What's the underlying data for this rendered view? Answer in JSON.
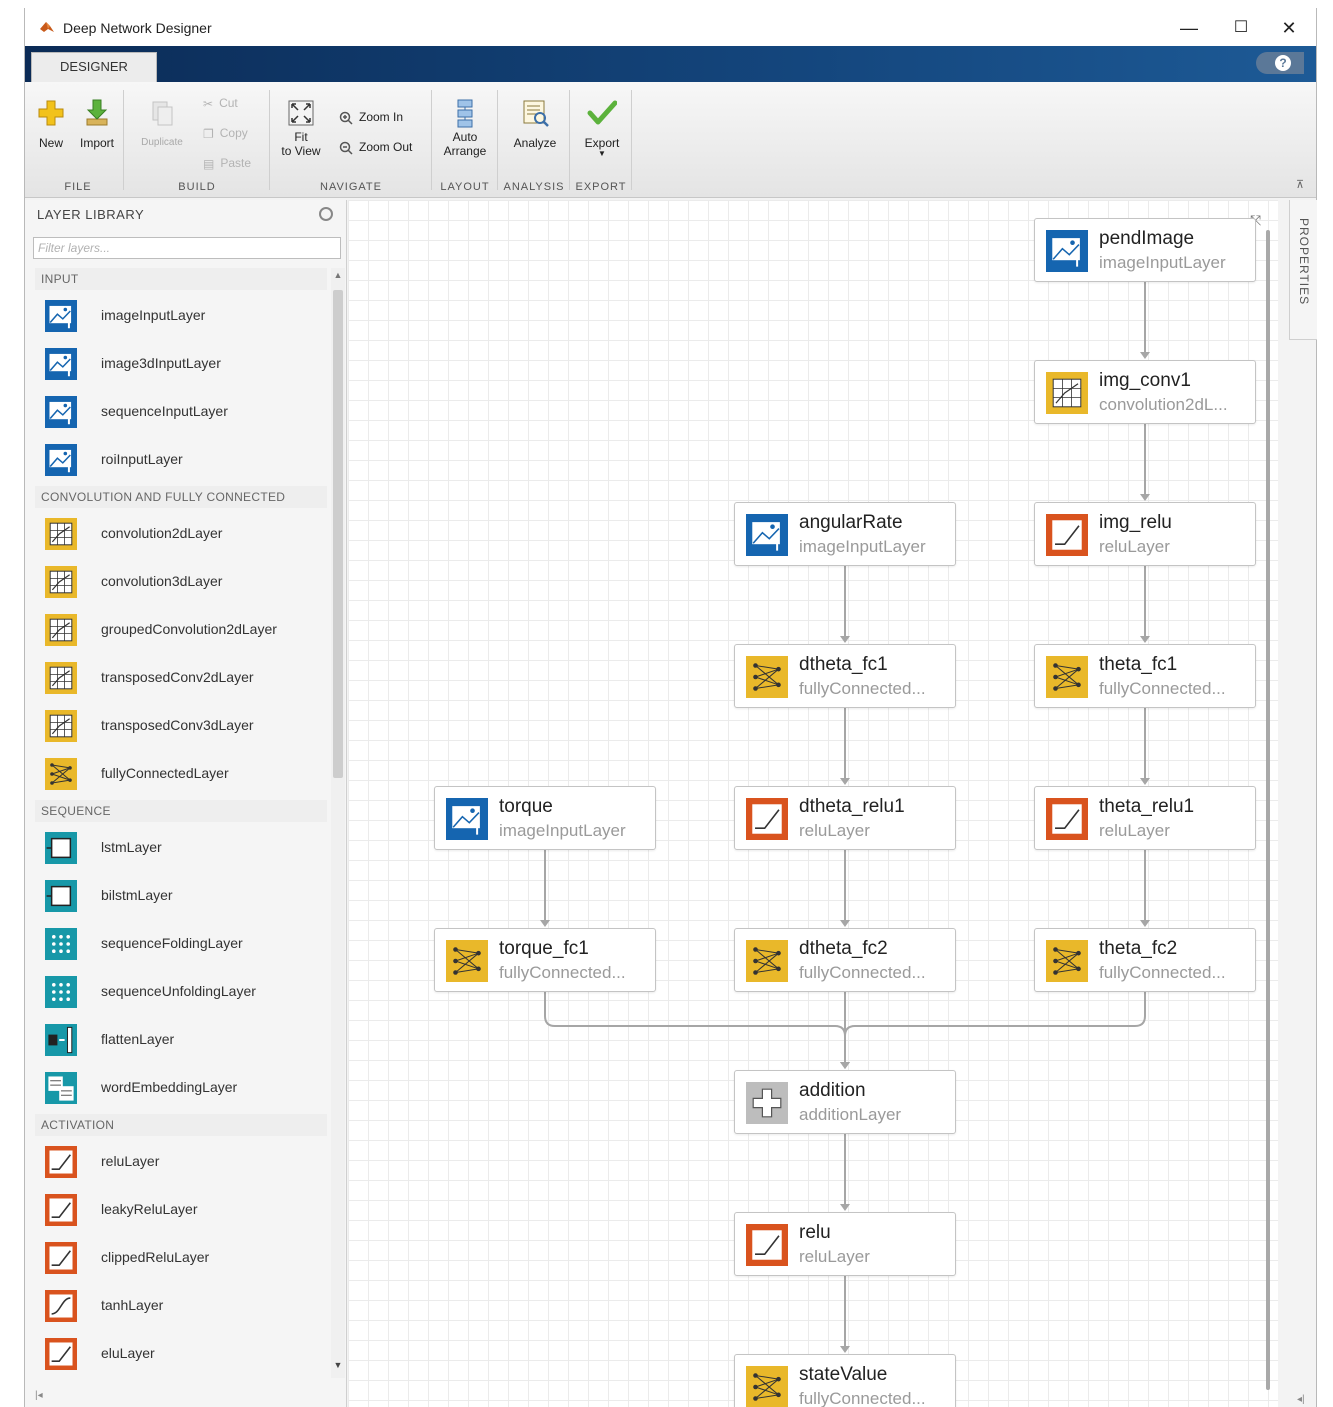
{
  "window": {
    "title": "Deep Network Designer"
  },
  "window_controls": {
    "minimize": "—",
    "maximize": "☐",
    "close": "✕"
  },
  "tabs": [
    {
      "label": "DESIGNER"
    }
  ],
  "help": {
    "label": "?"
  },
  "toolstrip": {
    "new": "New",
    "import": "Import",
    "duplicate": "Duplicate",
    "cut": "Cut",
    "copy": "Copy",
    "paste": "Paste",
    "fit_line1": "Fit",
    "fit_line2": "to View",
    "zoom_in": "Zoom In",
    "zoom_out": "Zoom Out",
    "auto_line1": "Auto",
    "auto_line2": "Arrange",
    "analyze": "Analyze",
    "export": "Export",
    "sections": {
      "file": "FILE",
      "build": "BUILD",
      "navigate": "NAVIGATE",
      "layout": "LAYOUT",
      "analysis": "ANALYSIS",
      "export": "EXPORT"
    }
  },
  "library": {
    "title": "LAYER LIBRARY",
    "filter_placeholder": "Filter layers...",
    "categories": [
      {
        "label": "INPUT",
        "items": [
          {
            "label": "imageInputLayer",
            "icon": "image-input-icon",
            "color": "#1565b0"
          },
          {
            "label": "image3dInputLayer",
            "icon": "image3d-input-icon",
            "color": "#1565b0"
          },
          {
            "label": "sequenceInputLayer",
            "icon": "sequence-input-icon",
            "color": "#1565b0"
          },
          {
            "label": "roiInputLayer",
            "icon": "roi-input-icon",
            "color": "#1565b0"
          }
        ]
      },
      {
        "label": "CONVOLUTION AND FULLY CONNECTED",
        "items": [
          {
            "label": "convolution2dLayer",
            "icon": "convolution-icon",
            "color": "#e9b82a"
          },
          {
            "label": "convolution3dLayer",
            "icon": "convolution-icon",
            "color": "#e9b82a"
          },
          {
            "label": "groupedConvolution2dLayer",
            "icon": "convolution-icon",
            "color": "#e9b82a"
          },
          {
            "label": "transposedConv2dLayer",
            "icon": "convolution-icon",
            "color": "#e9b82a"
          },
          {
            "label": "transposedConv3dLayer",
            "icon": "convolution-icon",
            "color": "#e9b82a"
          },
          {
            "label": "fullyConnectedLayer",
            "icon": "fully-connected-icon",
            "color": "#e9b82a"
          }
        ]
      },
      {
        "label": "SEQUENCE",
        "items": [
          {
            "label": "lstmLayer",
            "icon": "lstm-icon",
            "color": "#1798a8"
          },
          {
            "label": "bilstmLayer",
            "icon": "bilstm-icon",
            "color": "#1798a8"
          },
          {
            "label": "sequenceFoldingLayer",
            "icon": "sequence-folding-icon",
            "color": "#1798a8"
          },
          {
            "label": "sequenceUnfoldingLayer",
            "icon": "sequence-unfolding-icon",
            "color": "#1798a8"
          },
          {
            "label": "flattenLayer",
            "icon": "flatten-icon",
            "color": "#1798a8"
          },
          {
            "label": "wordEmbeddingLayer",
            "icon": "word-embedding-icon",
            "color": "#1798a8"
          }
        ]
      },
      {
        "label": "ACTIVATION",
        "items": [
          {
            "label": "reluLayer",
            "icon": "relu-icon",
            "color": "#d9531e"
          },
          {
            "label": "leakyReluLayer",
            "icon": "relu-icon",
            "color": "#d9531e"
          },
          {
            "label": "clippedReluLayer",
            "icon": "relu-icon",
            "color": "#d9531e"
          },
          {
            "label": "tanhLayer",
            "icon": "tanh-icon",
            "color": "#d9531e"
          },
          {
            "label": "eluLayer",
            "icon": "relu-icon",
            "color": "#d9531e"
          }
        ]
      }
    ]
  },
  "network": {
    "nodes": [
      {
        "id": "pendImage",
        "name": "pendImage",
        "type": "imageInputLayer",
        "kind": "input"
      },
      {
        "id": "img_conv1",
        "name": "img_conv1",
        "type": "convolution2dL...",
        "kind": "conv"
      },
      {
        "id": "img_relu",
        "name": "img_relu",
        "type": "reluLayer",
        "kind": "relu"
      },
      {
        "id": "angularRate",
        "name": "angularRate",
        "type": "imageInputLayer",
        "kind": "input"
      },
      {
        "id": "dtheta_fc1",
        "name": "dtheta_fc1",
        "type": "fullyConnected...",
        "kind": "fc"
      },
      {
        "id": "theta_fc1",
        "name": "theta_fc1",
        "type": "fullyConnected...",
        "kind": "fc"
      },
      {
        "id": "torque",
        "name": "torque",
        "type": "imageInputLayer",
        "kind": "input"
      },
      {
        "id": "dtheta_relu1",
        "name": "dtheta_relu1",
        "type": "reluLayer",
        "kind": "relu"
      },
      {
        "id": "theta_relu1",
        "name": "theta_relu1",
        "type": "reluLayer",
        "kind": "relu"
      },
      {
        "id": "torque_fc1",
        "name": "torque_fc1",
        "type": "fullyConnected...",
        "kind": "fc"
      },
      {
        "id": "dtheta_fc2",
        "name": "dtheta_fc2",
        "type": "fullyConnected...",
        "kind": "fc"
      },
      {
        "id": "theta_fc2",
        "name": "theta_fc2",
        "type": "fullyConnected...",
        "kind": "fc"
      },
      {
        "id": "addition",
        "name": "addition",
        "type": "additionLayer",
        "kind": "addition"
      },
      {
        "id": "relu",
        "name": "relu",
        "type": "reluLayer",
        "kind": "relu"
      },
      {
        "id": "stateValue",
        "name": "stateValue",
        "type": "fullyConnected...",
        "kind": "fc"
      }
    ],
    "edges": [
      [
        "pendImage",
        "img_conv1"
      ],
      [
        "img_conv1",
        "img_relu"
      ],
      [
        "img_relu",
        "theta_fc1"
      ],
      [
        "theta_fc1",
        "theta_relu1"
      ],
      [
        "theta_relu1",
        "theta_fc2"
      ],
      [
        "angularRate",
        "dtheta_fc1"
      ],
      [
        "dtheta_fc1",
        "dtheta_relu1"
      ],
      [
        "dtheta_relu1",
        "dtheta_fc2"
      ],
      [
        "torque",
        "torque_fc1"
      ],
      [
        "torque_fc1",
        "addition"
      ],
      [
        "dtheta_fc2",
        "addition"
      ],
      [
        "theta_fc2",
        "addition"
      ],
      [
        "addition",
        "relu"
      ],
      [
        "relu",
        "stateValue"
      ]
    ]
  },
  "properties": {
    "label": "PROPERTIES"
  },
  "colors": {
    "input": "#1565b0",
    "conv": "#e9b82a",
    "fc": "#e9b82a",
    "relu": "#d9531e",
    "sequence": "#1798a8",
    "addition": "#bdbdbd",
    "title_bar": "#0b2b56",
    "grid": "#ebebeb"
  }
}
